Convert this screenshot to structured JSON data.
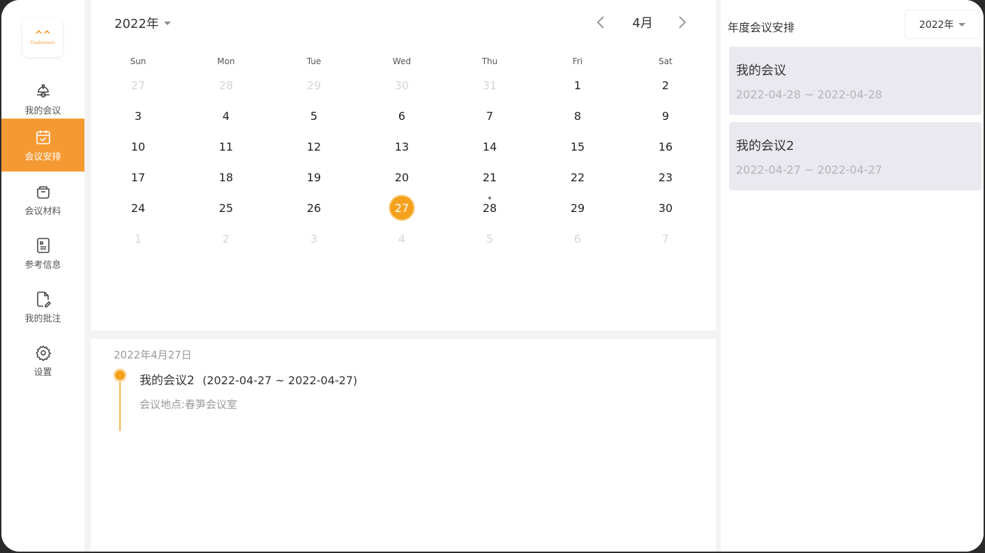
{
  "app": {
    "logo_mark": "^^",
    "logo_text": "Conference"
  },
  "sidebar": {
    "items": [
      {
        "label": "我的会议",
        "icon": "meeting-icon",
        "active": false
      },
      {
        "label": "会议安排",
        "icon": "calendar-check-icon",
        "active": true
      },
      {
        "label": "会议材料",
        "icon": "folder-icon",
        "active": false
      },
      {
        "label": "参考信息",
        "icon": "document-icon",
        "active": false
      },
      {
        "label": "我的批注",
        "icon": "file-edit-icon",
        "active": false
      },
      {
        "label": "设置",
        "icon": "gear-icon",
        "active": false
      }
    ],
    "accent_color": "#f59a33"
  },
  "calendar": {
    "year_label": "2022年",
    "month_label": "4月",
    "weekdays": [
      "Sun",
      "Mon",
      "Tue",
      "Wed",
      "Thu",
      "Fri",
      "Sat"
    ],
    "weeks": [
      [
        {
          "d": "27",
          "other": true
        },
        {
          "d": "28",
          "other": true
        },
        {
          "d": "29",
          "other": true
        },
        {
          "d": "30",
          "other": true
        },
        {
          "d": "31",
          "other": true
        },
        {
          "d": "1"
        },
        {
          "d": "2"
        }
      ],
      [
        {
          "d": "3"
        },
        {
          "d": "4"
        },
        {
          "d": "5"
        },
        {
          "d": "6"
        },
        {
          "d": "7"
        },
        {
          "d": "8"
        },
        {
          "d": "9"
        }
      ],
      [
        {
          "d": "10"
        },
        {
          "d": "11"
        },
        {
          "d": "12"
        },
        {
          "d": "13"
        },
        {
          "d": "14"
        },
        {
          "d": "15"
        },
        {
          "d": "16"
        }
      ],
      [
        {
          "d": "17"
        },
        {
          "d": "18"
        },
        {
          "d": "19"
        },
        {
          "d": "20"
        },
        {
          "d": "21"
        },
        {
          "d": "22"
        },
        {
          "d": "23"
        }
      ],
      [
        {
          "d": "24"
        },
        {
          "d": "25"
        },
        {
          "d": "26"
        },
        {
          "d": "27",
          "today": true,
          "event": true
        },
        {
          "d": "28",
          "event": true
        },
        {
          "d": "29"
        },
        {
          "d": "30"
        }
      ],
      [
        {
          "d": "1",
          "other": true
        },
        {
          "d": "2",
          "other": true
        },
        {
          "d": "3",
          "other": true
        },
        {
          "d": "4",
          "other": true
        },
        {
          "d": "5",
          "other": true
        },
        {
          "d": "6",
          "other": true
        },
        {
          "d": "7",
          "other": true
        }
      ]
    ],
    "today_color": "#f5a11e"
  },
  "agenda": {
    "date": "2022年4月27日",
    "event_title": "我的会议2",
    "event_range": "(2022-04-27 ~ 2022-04-27)",
    "event_location": "会议地点:春笋会议室"
  },
  "annual": {
    "title": "年度会议安排",
    "year_select": "2022年",
    "meetings": [
      {
        "name": "我的会议",
        "range": "2022-04-28 ~ 2022-04-28"
      },
      {
        "name": "我的会议2",
        "range": "2022-04-27 ~ 2022-04-27"
      }
    ]
  }
}
